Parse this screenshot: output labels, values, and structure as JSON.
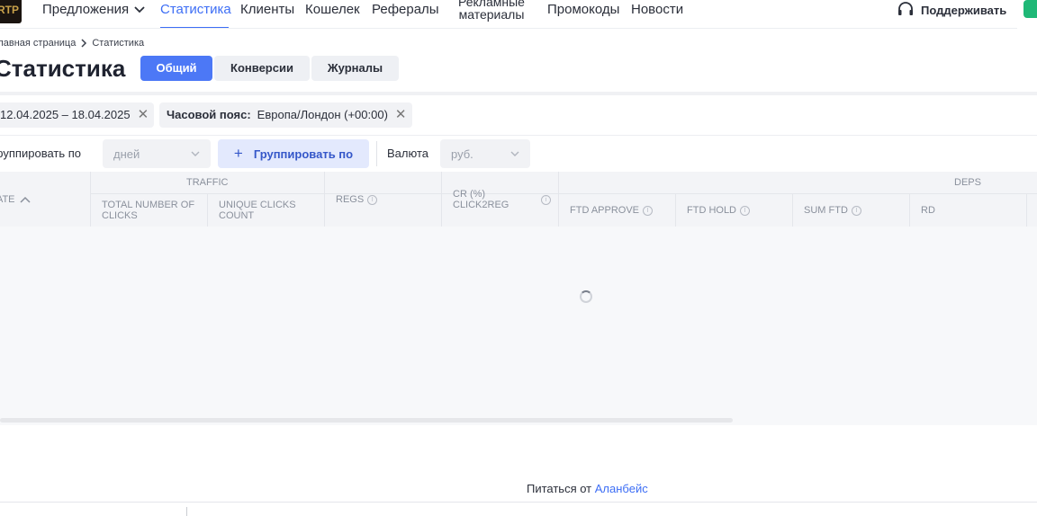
{
  "nav": {
    "logo_text": "RTP",
    "items": [
      "Предложения",
      "Статистика",
      "Клиенты",
      "Кошелек",
      "Рефералы",
      "Рекламные материалы",
      "Промокоды",
      "Новости"
    ],
    "support": "Поддерживать"
  },
  "breadcrumb": {
    "home": "Главная страница",
    "current": "Статистика"
  },
  "page": {
    "title": "Статистика"
  },
  "tabs": [
    "Общий",
    "Конверсии",
    "Журналы"
  ],
  "filters": {
    "date_range": "12.04.2025 – 18.04.2025",
    "timezone_label": "Часовой пояс:",
    "timezone_value": "Европа/Лондон (+00:00)"
  },
  "grouping": {
    "group_by_label": "Группировать по",
    "group_by_value": "дней",
    "group_button": "Группировать по",
    "currency_label": "Валюта",
    "currency_value": "руб."
  },
  "table": {
    "groups": {
      "traffic": "TRAFFIC",
      "deps": "DEPS"
    },
    "columns": {
      "date": "DATE",
      "total_clicks": "TOTAL NUMBER OF CLICKS",
      "unique_clicks": "UNIQUE CLICKS COUNT",
      "regs": "REGS",
      "cr": "CR (%) CLICK2REG",
      "ftd_approve": "FTD APPROVE",
      "ftd_hold": "FTD HOLD",
      "sum_ftd": "SUM FTD",
      "rd": "RD"
    }
  },
  "footer": {
    "powered_label": "Питаться от",
    "powered_link": "Аланбейс"
  },
  "colors": {
    "accent": "#3d6ef5",
    "tab_active": "#4c78f6",
    "support_green": "#1fb877"
  },
  "icons": {
    "chevron": "chevron-down-icon",
    "close": "close-icon",
    "headset": "headset-icon",
    "plus": "plus-icon",
    "info": "info-icon",
    "sort": "sort-up-icon",
    "loading": "loading-spinner-icon"
  }
}
